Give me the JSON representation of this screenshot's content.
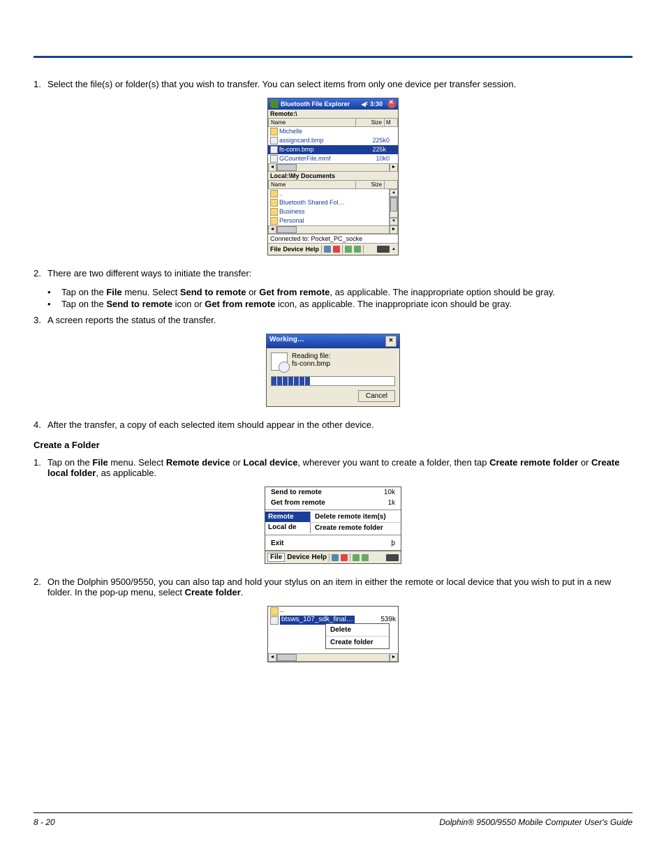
{
  "step1": "Select the file(s) or folder(s) that you wish to transfer. You can select items from only one device per transfer session.",
  "step2_intro": "There are two different ways to initiate the transfer:",
  "step2_b1a": "Tap on the ",
  "step2_b1b": "File",
  "step2_b1c": " menu. Select ",
  "step2_b1d": "Send to remote",
  "step2_b1e": " or ",
  "step2_b1f": "Get from remote",
  "step2_b1g": ", as applicable. The inappropriate option should be gray.",
  "step2_b2a": "Tap on the ",
  "step2_b2b": "Send to remote",
  "step2_b2c": " icon or ",
  "step2_b2d": "Get from remote",
  "step2_b2e": " icon, as applicable. The inappropriate icon should be gray.",
  "step3": "A screen reports the status of the transfer.",
  "step4": "After the transfer, a copy of each selected item should appear in the other device.",
  "create_heading": "Create a Folder",
  "cf1a": "Tap on the ",
  "cf1b": "File",
  "cf1c": " menu. Select ",
  "cf1d": "Remote device",
  "cf1e": " or ",
  "cf1f": "Local device",
  "cf1g": ", wherever you want to create a folder, then tap ",
  "cf1h": "Create remote folder",
  "cf1i": " or ",
  "cf1j": "Create local folder",
  "cf1k": ", as applicable.",
  "cf2a": "On the Dolphin 9500/9550, you can also tap and hold your stylus on an item in either the remote or local device that you wish to put in a new folder. In the pop-up menu, select ",
  "cf2b": "Create folder",
  "cf2c": ".",
  "shot1": {
    "title": "Bluetooth File Explorer",
    "time": "3:30",
    "remote_label": "Remote:\\",
    "col_name": "Name",
    "col_size": "Size",
    "col_m": "M",
    "remote_files": [
      {
        "name": "Michelle",
        "size": "",
        "m": "",
        "folder": true,
        "sel": false
      },
      {
        "name": "assigncard.bmp",
        "size": "225k",
        "m": "0",
        "folder": false,
        "sel": false
      },
      {
        "name": "fs-conn.bmp",
        "size": "225k",
        "m": "0",
        "folder": false,
        "sel": true
      },
      {
        "name": "GCounterFile.mmf",
        "size": "10k",
        "m": "0",
        "folder": false,
        "sel": false
      }
    ],
    "local_label": "Local:\\My Documents",
    "local_files": [
      {
        "name": "..",
        "folder": true
      },
      {
        "name": "Bluetooth Shared Fol…",
        "folder": true
      },
      {
        "name": "Business",
        "folder": true
      },
      {
        "name": "Personal",
        "folder": true
      }
    ],
    "status": "Connected to: Pocket_PC_socke",
    "menu_file": "File",
    "menu_device": "Device",
    "menu_help": "Help"
  },
  "shot2": {
    "title": "Working…",
    "line1": "Reading file:",
    "line2": "fs-conn.bmp",
    "cancel": "Cancel"
  },
  "shot3": {
    "send": "Send to remote",
    "send_val": "10k",
    "get": "Get from remote",
    "get_val": "1k",
    "remote": "Remote",
    "del_remote": "Delete remote item(s)",
    "local": "Local de",
    "create_remote": "Create remote folder",
    "exit": "Exit",
    "menu_file": "File",
    "menu_device": "Device",
    "menu_help": "Help"
  },
  "shot4": {
    "up": "..",
    "sel_file": "btsws_107_sdk_final…",
    "sel_size": "539k",
    "ctx_delete": "Delete",
    "ctx_create": "Create folder"
  },
  "n1": "1.",
  "n2": "2.",
  "n3": "3.",
  "n4": "4.",
  "bul": "•",
  "footer_page": "8 - 20",
  "footer_title": "Dolphin® 9500/9550 Mobile Computer User's Guide"
}
